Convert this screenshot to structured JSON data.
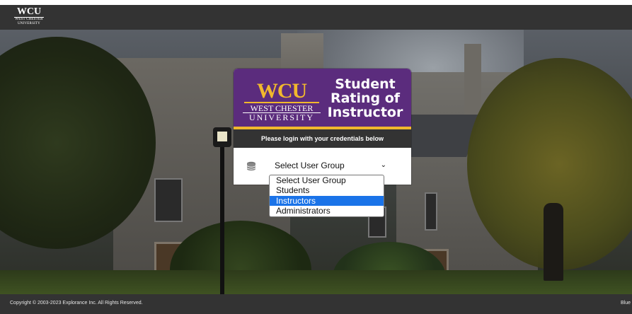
{
  "header": {
    "logo": {
      "main": "WCU",
      "line1": "WEST CHESTER",
      "line2": "UNIVERSITY"
    }
  },
  "login": {
    "brand": {
      "main": "WCU",
      "line1": "WEST CHESTER",
      "line2": "UNIVERSITY"
    },
    "title_lines": [
      "Student",
      "Rating of",
      "Instructor"
    ],
    "instruction": "Please login with your credentials below",
    "user_group": {
      "icon": "database-icon",
      "selected": "Select User Group",
      "options": [
        "Select User Group",
        "Students",
        "Instructors",
        "Administrators"
      ],
      "highlighted": "Instructors"
    }
  },
  "footer": {
    "copyright": "Copyright © 2003-2023 Explorance Inc. All Rights Reserved.",
    "right_text": "Blue"
  },
  "colors": {
    "purple": "#5b2c7d",
    "gold": "#f1b82d",
    "dark_bar": "#333333",
    "highlight": "#1a73e8"
  }
}
